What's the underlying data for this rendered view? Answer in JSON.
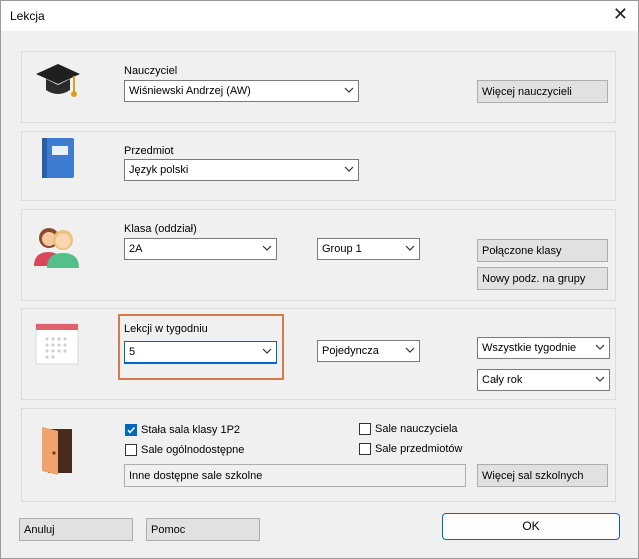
{
  "window": {
    "title": "Lekcja"
  },
  "teacher": {
    "label": "Nauczyciel",
    "value": "Wiśniewski Andrzej (AW)",
    "more_button": "Więcej nauczycieli"
  },
  "subject": {
    "label": "Przedmiot",
    "value": "Język polski"
  },
  "class": {
    "label": "Klasa (oddział)",
    "value": "2A",
    "group_value": "Group 1",
    "joined_button": "Połączone klasy",
    "new_split_button": "Nowy podz. na grupy"
  },
  "lessons": {
    "label": "Lekcji w tygodniu",
    "value": "5",
    "type_value": "Pojedyncza",
    "weeks_value": "Wszystkie tygodnie",
    "term_value": "Cały rok"
  },
  "rooms": {
    "fixed_room_label": "Stała sala klasy 1P2",
    "fixed_room_checked": true,
    "public_rooms_label": "Sale ogólnodostępne",
    "public_rooms_checked": false,
    "teacher_rooms_label": "Sale nauczyciela",
    "teacher_rooms_checked": false,
    "subject_rooms_label": "Sale przedmiotów",
    "subject_rooms_checked": false,
    "other_rooms_text": "Inne dostępne sale szkolne",
    "more_rooms_button": "Więcej sal szkolnych"
  },
  "footer": {
    "cancel_button": "Anuluj",
    "help_button": "Pomoc",
    "ok_button": "OK"
  },
  "colors": {
    "accent": "#0067c0",
    "highlight": "#d57b4b"
  }
}
